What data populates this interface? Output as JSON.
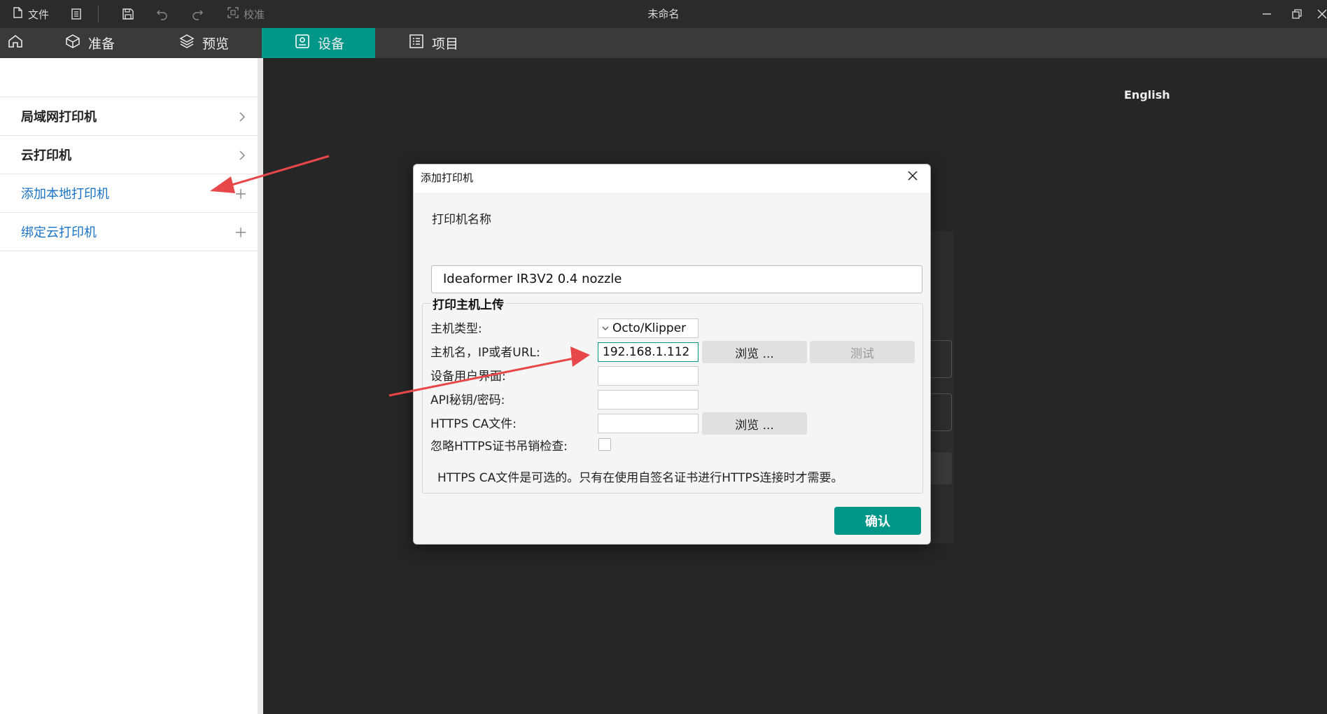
{
  "titlebar": {
    "file": "文件",
    "calibrate": "校准",
    "title": "未命名"
  },
  "tabs": [
    {
      "label": "准备"
    },
    {
      "label": "预览"
    },
    {
      "label": "设备"
    },
    {
      "label": "项目"
    }
  ],
  "sidebar": {
    "items": [
      {
        "label": "局域网打印机"
      },
      {
        "label": "云打印机"
      },
      {
        "label": "添加本地打印机"
      },
      {
        "label": "绑定云打印机"
      }
    ]
  },
  "language": "English",
  "dialog": {
    "title": "添加打印机",
    "printer_name_label": "打印机名称",
    "printer_name_value": "Ideaformer IR3V2 0.4 nozzle",
    "group_title": "打印主机上传",
    "host_type_label": "主机类型:",
    "host_type_value": "Octo/Klipper",
    "hostname_label": "主机名，IP或者URL:",
    "hostname_value": "192.168.1.112",
    "ui_label": "设备用户界面:",
    "ui_value": "",
    "api_label": "API秘钥/密码:",
    "api_value": "",
    "ca_label": "HTTPS CA文件:",
    "ca_value": "",
    "ignore_label": "忽略HTTPS证书吊销检查:",
    "browse_label": "浏览 ...",
    "test_label": "测试",
    "note": "HTTPS CA文件是可选的。只有在使用自签名证书进行HTTPS连接时才需要。",
    "ok_label": "确认"
  },
  "colors": {
    "accent": "#009688",
    "arrow": "#e8474a",
    "link": "#1a73c8"
  }
}
